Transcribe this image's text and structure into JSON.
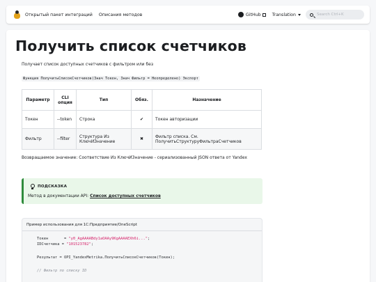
{
  "navbar": {
    "link1": "Открытый пакет интеграций",
    "link2": "Описания методов",
    "github": "GitHub",
    "translation": "Translation",
    "search_placeholder": "Search Ctrl+K"
  },
  "page": {
    "title": "Получить список счетчиков",
    "description": "Получает список доступных счетчиков с фильтром или без",
    "signature": "Функция ПолучитьСписокСчетчиков(Знач Токен, Знач Фильтр = Неопределено) Экспорт"
  },
  "table": {
    "headers": {
      "param": "Параметр",
      "cli1": "CLI",
      "cli2": "опция",
      "type": "Тип",
      "req": "Обяз.",
      "purpose": "Назначение"
    },
    "rows": [
      {
        "param": "Токен",
        "cli": "--token",
        "type1": "Строка",
        "type2": "",
        "req": "✔",
        "purpose1": "Токен авторизации",
        "purpose2": ""
      },
      {
        "param": "Фильтр",
        "cli": "--filter",
        "type1": "Структура Из",
        "type2": "КлючИЗначение",
        "req": "✖",
        "purpose1": "Фильтр списка. См.",
        "purpose2": "ПолучитьСтруктуруФильтраСчетчиков"
      }
    ]
  },
  "return_text": "Возвращаемое значение: Соответствие Из КлючИЗначение - сериализованный JSON ответа от Yandex",
  "tip": {
    "title": "ПОДСКАЗКА",
    "text": "Метод в документации API: ",
    "link": "Список доступных счетчиков"
  },
  "code": {
    "title": "Пример использования для 1С:Предприятие/OneScript",
    "l1a": "Токен       = ",
    "l1b": "\"y0_AgAAAABdy1aOAAy9KgAAAAEXh6i...\"",
    "l1c": ";",
    "l2a": "IDСчетчика = ",
    "l2b": "\"101523782\"",
    "l2c": ";",
    "l3": "Результат = OPI_YandexMetrika.ПолучитьСписокСчетчиков(Токен);",
    "l4": "// Фильтр по списку ID"
  }
}
